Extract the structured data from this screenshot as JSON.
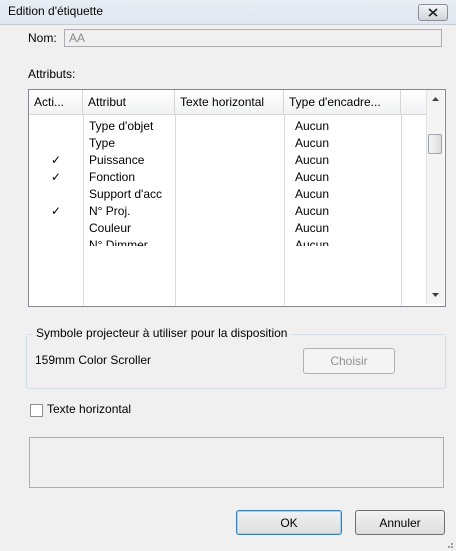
{
  "window": {
    "title": "Edition d'étiquette"
  },
  "name_field": {
    "label": "Nom:",
    "value": "AA"
  },
  "attributes": {
    "label": "Attributs:",
    "columns": [
      "Acti...",
      "Attribut",
      "Texte horizontal",
      "Type d'encadre..."
    ],
    "rows": [
      {
        "active": "",
        "attribut": "Type d'objet",
        "texte": "",
        "type": "Aucun"
      },
      {
        "active": "",
        "attribut": "Type",
        "texte": "",
        "type": "Aucun"
      },
      {
        "active": "✓",
        "attribut": "Puissance",
        "texte": "",
        "type": "Aucun"
      },
      {
        "active": "✓",
        "attribut": "Fonction",
        "texte": "",
        "type": "Aucun"
      },
      {
        "active": "",
        "attribut": "Support d'acc",
        "texte": "",
        "type": "Aucun"
      },
      {
        "active": "✓",
        "attribut": "N° Proj.",
        "texte": "",
        "type": "Aucun"
      },
      {
        "active": "",
        "attribut": "Couleur",
        "texte": "",
        "type": "Aucun"
      },
      {
        "active": "",
        "attribut": "N° Dimmer",
        "texte": "",
        "type": "Aucun"
      }
    ]
  },
  "symbol_group": {
    "legend": "Symbole projecteur à utiliser pour la disposition",
    "value": "159mm Color Scroller",
    "choose_label": "Choisir"
  },
  "horizontal_text": {
    "label": "Texte horizontal",
    "checked": false
  },
  "buttons": {
    "ok": "OK",
    "cancel": "Annuler"
  },
  "icons": {
    "close": "close-icon",
    "scroll_up": "chevron-up-icon",
    "scroll_down": "chevron-down-icon",
    "check": "checkmark-icon",
    "grip": "resize-grip-icon"
  }
}
